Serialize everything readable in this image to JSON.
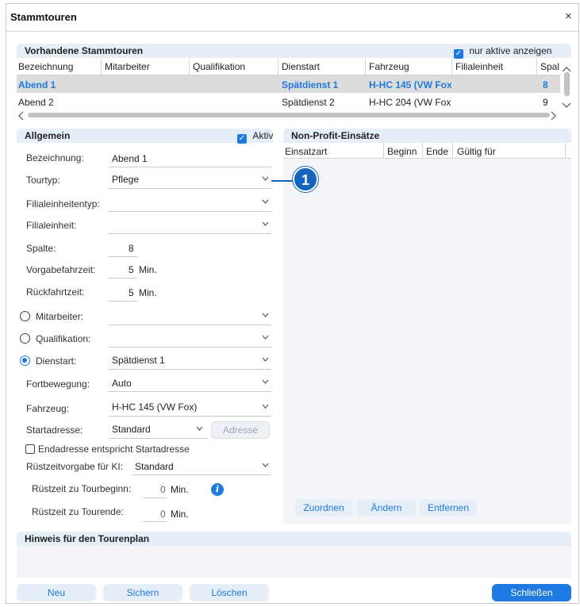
{
  "window": {
    "title": "Stammtouren",
    "close": "×"
  },
  "existing": {
    "header": "Vorhandene Stammtouren",
    "only_active": "nur aktive anzeigen",
    "columns": [
      "Bezeichnung",
      "Mitarbeiter",
      "Qualifikation",
      "Dienstart",
      "Fahrzeug",
      "Filialeinheit",
      "Spal"
    ],
    "rows": [
      {
        "bezeichnung": "Abend 1",
        "mitarbeiter": "",
        "qualifikation": "",
        "dienstart": "Spätdienst 1",
        "fahrzeug": "H-HC 145 (VW Fox",
        "filialeinheit": "",
        "spalte": "8",
        "selected": true
      },
      {
        "bezeichnung": "Abend 2",
        "mitarbeiter": "",
        "qualifikation": "",
        "dienstart": "Spätdienst 2",
        "fahrzeug": "H-HC 204 (VW Fox)",
        "filialeinheit": "",
        "spalte": "9",
        "selected": false
      }
    ]
  },
  "general": {
    "header": "Allgemein",
    "aktiv": "Aktiv",
    "bezeichnung": {
      "label": "Bezeichnung:",
      "value": "Abend 1"
    },
    "tourtyp": {
      "label": "Tourtyp:",
      "value": "Pflege"
    },
    "filialeinheitentyp": {
      "label": "Filialeinheitentyp:",
      "value": ""
    },
    "filialeinheit": {
      "label": "Filialeinheit:",
      "value": ""
    },
    "spalte": {
      "label": "Spalte:",
      "value": "8"
    },
    "vorgabefahrzeit": {
      "label": "Vorgabefahrzeit:",
      "value": "5",
      "unit": "Min."
    },
    "rueckfahrzeit": {
      "label": "Rückfahrtzeit:",
      "value": "5",
      "unit": "Min."
    },
    "mitarbeiter": {
      "label": "Mitarbeiter:",
      "value": ""
    },
    "qualifikation": {
      "label": "Qualifikation:",
      "value": ""
    },
    "dienstart": {
      "label": "Dienstart:",
      "value": "Spätdienst 1"
    },
    "fortbewegung": {
      "label": "Fortbewegung:",
      "value": "Auto"
    },
    "fahrzeug": {
      "label": "Fahrzeug:",
      "value": "H-HC 145 (VW Fox)"
    },
    "startadresse": {
      "label": "Startadresse:",
      "value": "Standard",
      "button": "Adresse"
    },
    "endadresse": "Endadresse entspricht Startadresse",
    "ruestzeitvorgabe": {
      "label": "Rüstzeitvorgabe für KI:",
      "value": "Standard"
    },
    "ruest_beginn": {
      "label": "Rüstzeit zu Tourbeginn:",
      "value": "0",
      "unit": "Min."
    },
    "ruest_ende": {
      "label": "Rüstzeit zu Tourende:",
      "value": "0",
      "unit": "Min."
    }
  },
  "nonprofit": {
    "header": "Non-Profit-Einsätze",
    "columns": [
      "Einsatzart",
      "Beginn",
      "Ende",
      "Gültig für"
    ],
    "buttons": {
      "assign": "Zuordnen",
      "change": "Ändern",
      "remove": "Entfernen"
    }
  },
  "callout": "1",
  "hint": {
    "header": "Hinweis für den Tourenplan"
  },
  "footer": {
    "new": "Neu",
    "save": "Sichern",
    "delete": "Löschen",
    "close": "Schließen"
  },
  "colors": {
    "accent": "#1e7ae0",
    "section_bg": "#e6eef8",
    "callout": "#1565c0"
  }
}
